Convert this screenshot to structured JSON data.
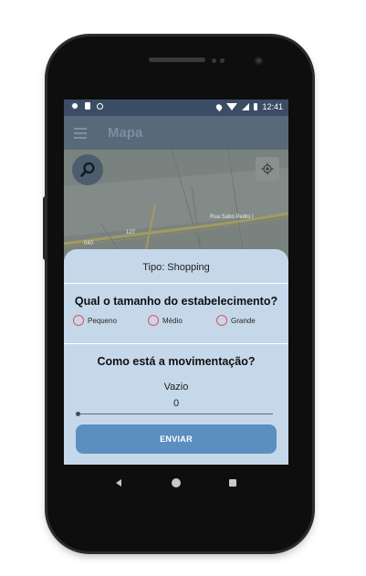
{
  "status_bar": {
    "time": "12:41",
    "icons": [
      "settings-icon",
      "sd-card-icon",
      "sync-icon",
      "location-icon",
      "wifi-icon",
      "signal-icon",
      "battery-icon"
    ]
  },
  "app_bar": {
    "title": "Mapa",
    "menu_icon": "menu-icon"
  },
  "map": {
    "search_icon": "search-icon",
    "locate_icon": "crosshair-icon",
    "street_label": "Rua Sabo Pedro I",
    "road_labels": [
      "127",
      "040"
    ]
  },
  "sheet": {
    "type_label": "Tipo: Shopping",
    "size_question": "Qual o tamanho do estabelecimento?",
    "size_options": [
      "Pequeno",
      "Médio",
      "Grande"
    ],
    "movement_question": "Como está a movimentação?",
    "movement_level_label": "Vazio",
    "movement_value": "0",
    "slider_fraction": 0,
    "submit_label": "ENVIAR"
  },
  "nav_bar": {
    "icons": [
      "back-icon",
      "home-icon",
      "recents-icon"
    ]
  },
  "colors": {
    "status_bar": "#3b4d64",
    "sheet_background": "#c5d8ea",
    "radio_outline": "#e24f55",
    "button": "#5a8fc0"
  }
}
